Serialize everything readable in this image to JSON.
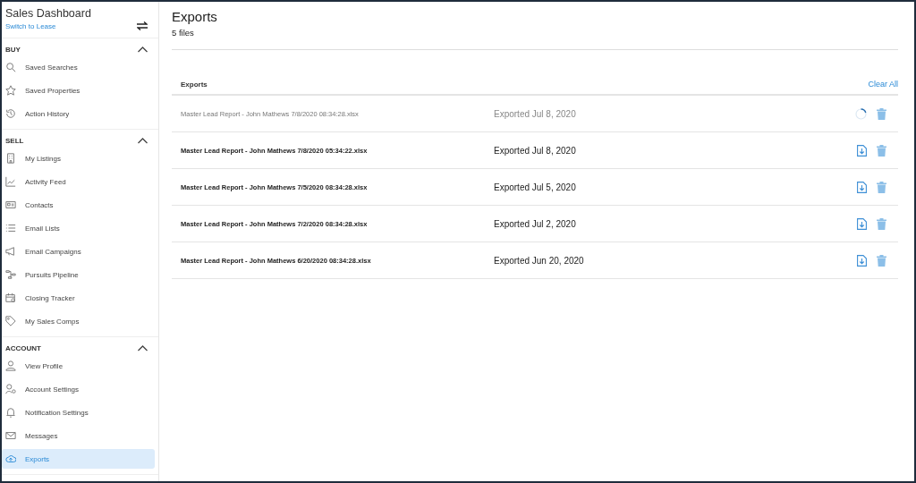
{
  "sidebar": {
    "title": "Sales Dashboard",
    "switch_link": "Switch to Lease",
    "sections": [
      {
        "label": "BUY",
        "expanded": true,
        "items": [
          {
            "label": "Saved Searches",
            "selected": false
          },
          {
            "label": "Saved Properties",
            "selected": false
          },
          {
            "label": "Action History",
            "selected": false
          }
        ]
      },
      {
        "label": "SELL",
        "expanded": true,
        "items": [
          {
            "label": "My Listings",
            "selected": false
          },
          {
            "label": "Activity Feed",
            "selected": false
          },
          {
            "label": "Contacts",
            "selected": false
          },
          {
            "label": "Email Lists",
            "selected": false
          },
          {
            "label": "Email Campaigns",
            "selected": false
          },
          {
            "label": "Pursuits Pipeline",
            "selected": false
          },
          {
            "label": "Closing Tracker",
            "selected": false
          },
          {
            "label": "My Sales Comps",
            "selected": false
          }
        ]
      },
      {
        "label": "ACCOUNT",
        "expanded": true,
        "items": [
          {
            "label": "View Profile",
            "selected": false
          },
          {
            "label": "Account Settings",
            "selected": false
          },
          {
            "label": "Notification Settings",
            "selected": false
          },
          {
            "label": "Messages",
            "selected": false
          },
          {
            "label": "Exports",
            "selected": true
          }
        ]
      }
    ]
  },
  "page": {
    "title": "Exports",
    "subtitle": "5 files"
  },
  "table": {
    "heading": "Exports",
    "clear_all": "Clear All",
    "rows": [
      {
        "file": "Master Lead Report - John Mathews 7/8/2020 08:34:28.xlsx",
        "date": "Exported Jul 8, 2020",
        "kind": "pending"
      },
      {
        "file": "Master Lead Report - John Mathews 7/8/2020 05:34:22.xlsx",
        "date": "Exported Jul 8, 2020",
        "kind": "done"
      },
      {
        "file": "Master Lead Report - John Mathews 7/5/2020 08:34:28.xlsx",
        "date": "Exported Jul 5, 2020",
        "kind": "done"
      },
      {
        "file": "Master Lead Report - John Mathews 7/2/2020 08:34:28.xlsx",
        "date": "Exported Jul 2, 2020",
        "kind": "done"
      },
      {
        "file": "Master Lead Report - John Mathews 6/20/2020 08:34:28.xlsx",
        "date": "Exported Jun 20, 2020",
        "kind": "done"
      }
    ]
  }
}
